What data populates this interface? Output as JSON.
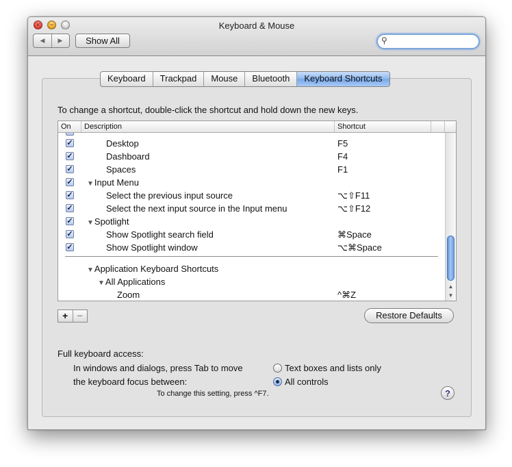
{
  "window": {
    "title": "Keyboard & Mouse"
  },
  "toolbar": {
    "back_label": "◀",
    "forward_label": "▶",
    "show_all_label": "Show All",
    "search_placeholder": ""
  },
  "tabs": [
    {
      "label": "Keyboard",
      "selected": false
    },
    {
      "label": "Trackpad",
      "selected": false
    },
    {
      "label": "Mouse",
      "selected": false
    },
    {
      "label": "Bluetooth",
      "selected": false
    },
    {
      "label": "Keyboard Shortcuts",
      "selected": true
    }
  ],
  "instructions": "To change a shortcut, double-click the shortcut and hold down the new keys.",
  "outline": {
    "columns": {
      "on": "On",
      "description": "Description",
      "shortcut": "Shortcut"
    },
    "rows": [
      {
        "description": "Desktop",
        "shortcut": "F5",
        "checked": true,
        "level": 2,
        "group": false
      },
      {
        "description": "Dashboard",
        "shortcut": "F4",
        "checked": true,
        "level": 2,
        "group": false
      },
      {
        "description": "Spaces",
        "shortcut": "F1",
        "checked": true,
        "level": 2,
        "group": false
      },
      {
        "description": "Input Menu",
        "shortcut": "",
        "checked": true,
        "level": 1,
        "group": true
      },
      {
        "description": "Select the previous input source",
        "shortcut": "⌥⇧F11",
        "checked": true,
        "level": 2,
        "group": false
      },
      {
        "description": "Select the next input source in the Input menu",
        "shortcut": "⌥⇧F12",
        "checked": true,
        "level": 2,
        "group": false
      },
      {
        "description": "Spotlight",
        "shortcut": "",
        "checked": true,
        "level": 1,
        "group": true
      },
      {
        "description": "Show Spotlight search field",
        "shortcut": "⌘Space",
        "checked": true,
        "level": 2,
        "group": false
      },
      {
        "description": "Show Spotlight window",
        "shortcut": "⌥⌘Space",
        "checked": true,
        "level": 2,
        "group": false
      }
    ],
    "app_rows": [
      {
        "description": "Application Keyboard Shortcuts",
        "shortcut": "",
        "level": 1,
        "group": true
      },
      {
        "description": "All Applications",
        "shortcut": "",
        "level": 2,
        "group": true
      },
      {
        "description": "Zoom",
        "shortcut": "^⌘Z",
        "level": 3,
        "group": false
      }
    ]
  },
  "buttons": {
    "add": "+",
    "remove": "−",
    "restore_defaults": "Restore Defaults"
  },
  "full_keyboard_access": {
    "label": "Full keyboard access:",
    "description_line1": "In windows and dialogs, press Tab to move",
    "description_line2": "the keyboard focus between:",
    "options": [
      {
        "label": "Text boxes and lists only",
        "selected": false
      },
      {
        "label": "All controls",
        "selected": true
      }
    ],
    "note": "To change this setting, press ^F7."
  },
  "help_label": "?"
}
